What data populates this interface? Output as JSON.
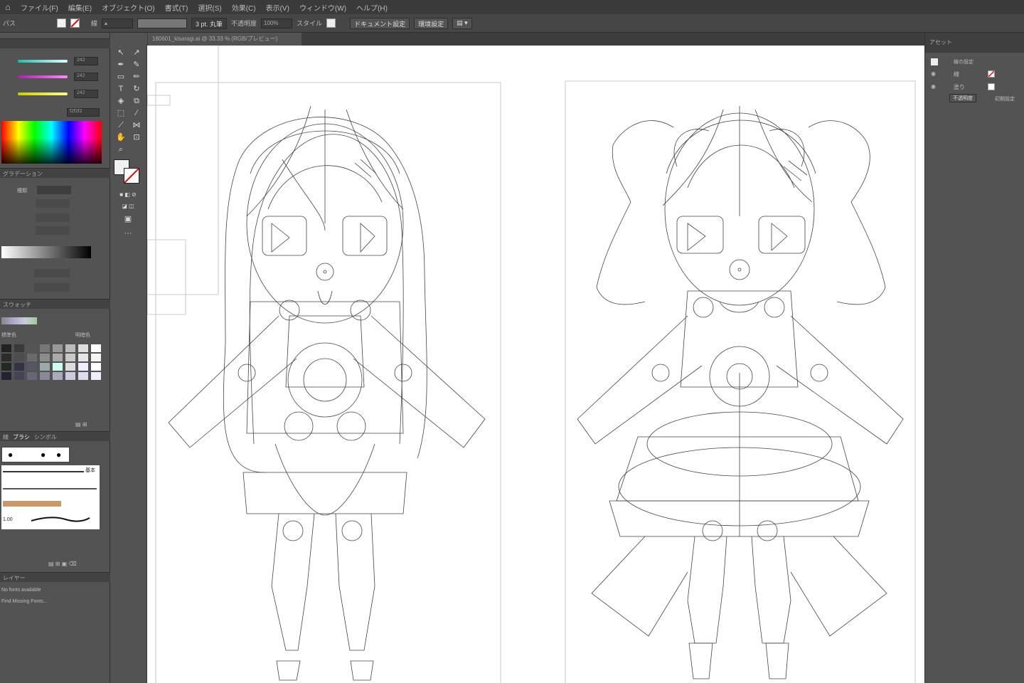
{
  "menu": [
    "ファイル(F)",
    "編集(E)",
    "オブジェクト(O)",
    "書式(T)",
    "選択(S)",
    "効果(C)",
    "表示(V)",
    "ウィンドウ(W)",
    "ヘルプ(H)"
  ],
  "control": {
    "label": "パス",
    "stroke_label": "線",
    "style_label": "3 pt. 丸筆",
    "opacity_label": "不透明度",
    "opacity_value": "100%",
    "style2_label": "スタイル",
    "doc_settings": "ドキュメント設定",
    "prefs": "環境設定"
  },
  "doc_tab": "180601_kisaragi.ai @ 33.33 % (RGB/プレビュー)",
  "color_panel": {
    "r": "242",
    "g": "242",
    "b": "242",
    "hex": "f2f2f2"
  },
  "gradient_panel": {
    "title": "グラデーション",
    "type": "種類"
  },
  "swatch_panel": {
    "title": "スウォッチ",
    "col1": "標準色",
    "col2": "明暗色"
  },
  "brush_panel": {
    "tabs": [
      "線",
      "ブラシ",
      "シンボル"
    ],
    "size_label": "基本",
    "size_value": "1.00"
  },
  "info_panel": {
    "title": "レイヤー",
    "line1": "No fonts available",
    "line2": "Find Missing Fonts..."
  },
  "right_panel": {
    "title": "アセット",
    "tab": "線の設定",
    "layers": [
      {
        "name": "線"
      },
      {
        "name": "塗り"
      }
    ],
    "btn1": "不透明度",
    "btn2": "初期設定"
  },
  "colors": {
    "bg": "#535353",
    "canvas": "#ffffff",
    "menubar": "#3a3a3a"
  }
}
